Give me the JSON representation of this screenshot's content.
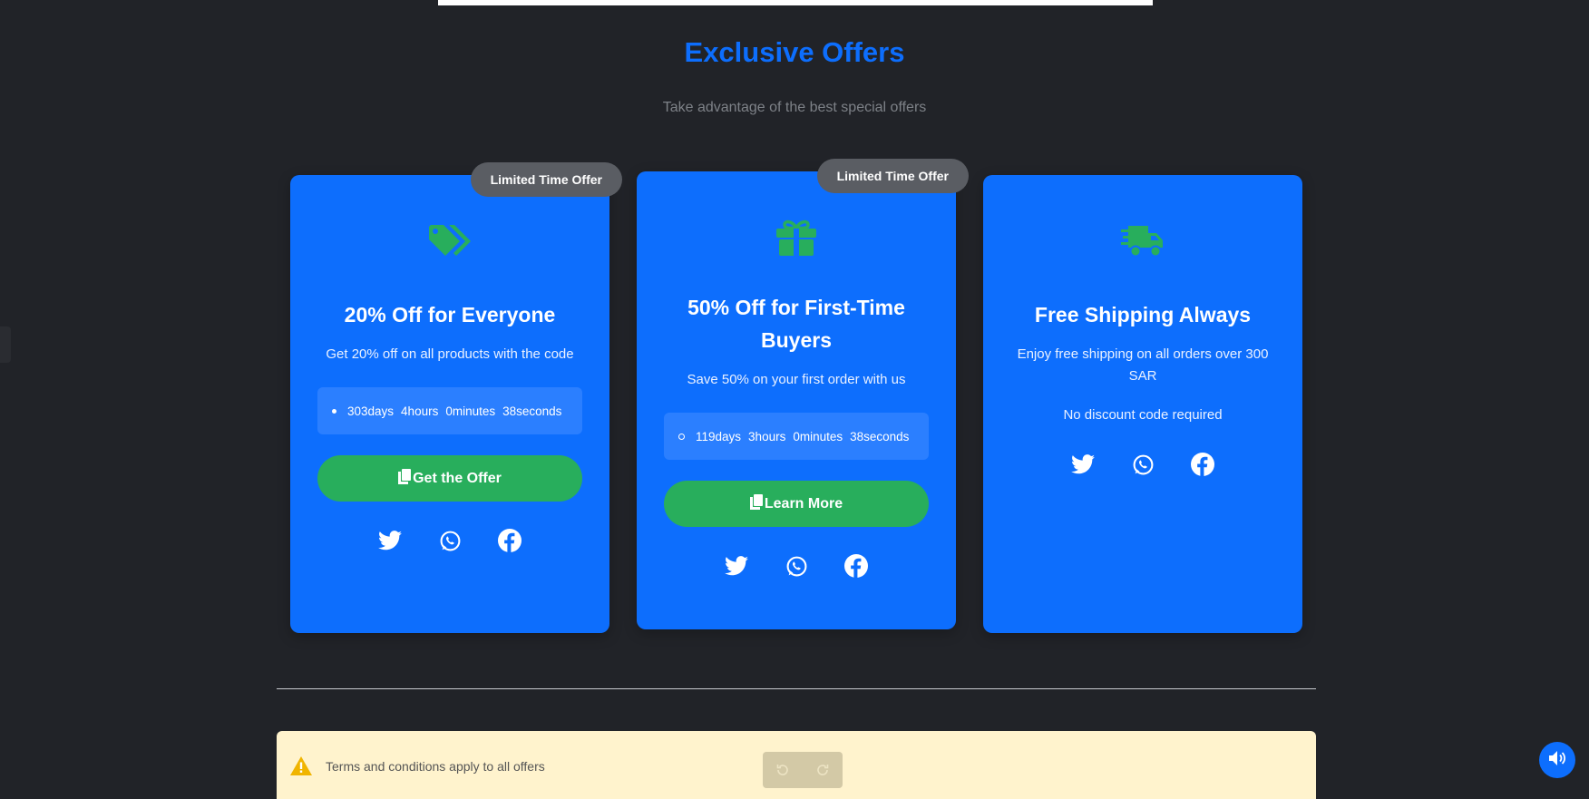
{
  "header": {
    "title": "Exclusive Offers",
    "subtitle": "Take advantage of the best special offers"
  },
  "cards": [
    {
      "badge": "Limited Time Offer",
      "icon": "tags-icon",
      "title": "20% Off for Everyone",
      "description": "Get 20% off on all products with the code",
      "countdown": {
        "days": "303days",
        "hours": "4hours",
        "minutes": "0minutes",
        "seconds": "38seconds"
      },
      "button": "Get the Offer"
    },
    {
      "badge": "Limited Time Offer",
      "icon": "gift-icon",
      "title": "50% Off for First-Time Buyers",
      "description": "Save 50% on your first order with us",
      "countdown": {
        "days": "119days",
        "hours": "3hours",
        "minutes": "0minutes",
        "seconds": "38seconds"
      },
      "button": "Learn More"
    },
    {
      "icon": "shipping-fast-icon",
      "title": "Free Shipping Always",
      "description": "Enjoy free shipping on all orders over 300 SAR",
      "note": "No discount code required"
    }
  ],
  "terms": {
    "text": "Terms and conditions apply to all offers"
  },
  "colors": {
    "background": "#212328",
    "accent": "#0d6efd",
    "cta": "#28ae5c",
    "icon_green": "#28ae5c",
    "terms_bg": "#fff3cd"
  }
}
